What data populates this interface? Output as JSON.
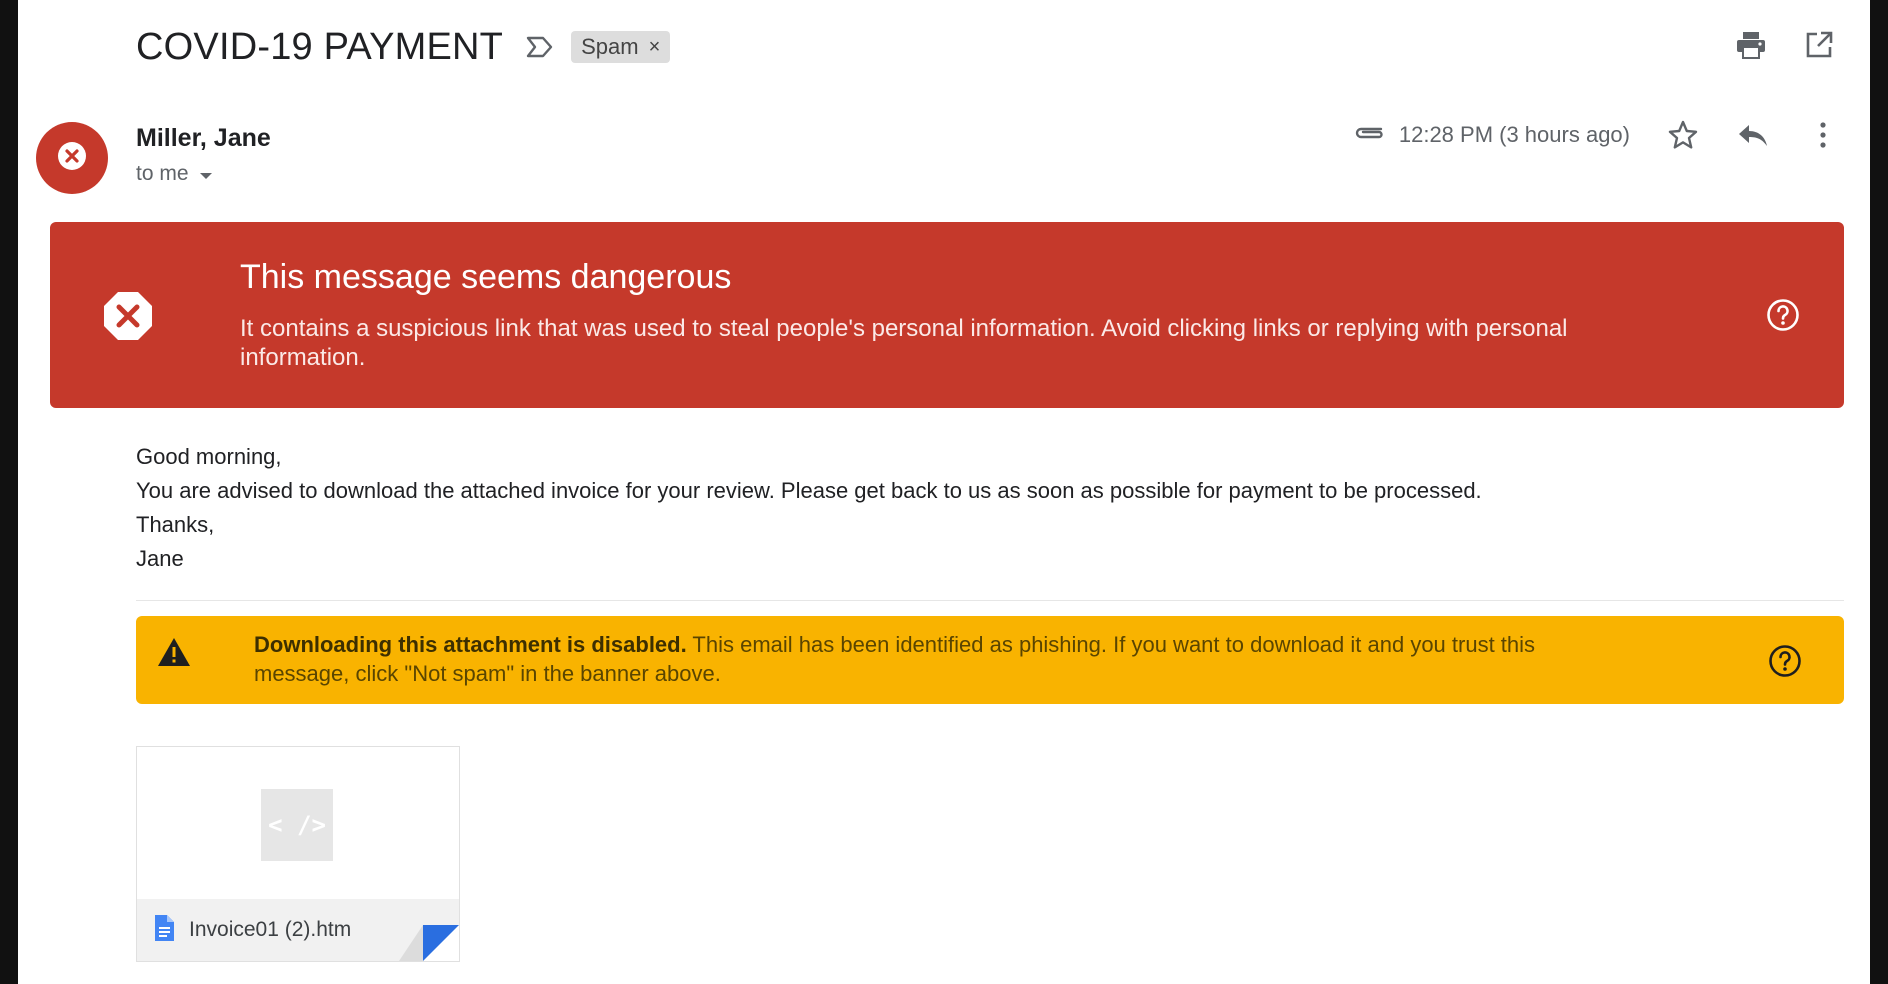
{
  "header": {
    "subject": "COVID-19 PAYMENT",
    "label": "Spam",
    "label_remove": "×",
    "important_icon": "important-marker-icon",
    "actions": [
      "print-icon",
      "open-new-window-icon"
    ]
  },
  "sender": {
    "avatar_icon": "error-x-icon",
    "name": "Miller, Jane",
    "recipient": "to me",
    "timestamp": "12:28 PM (3 hours ago)",
    "icons": [
      "attachment-icon",
      "star-icon",
      "reply-icon",
      "more-vert-icon"
    ]
  },
  "danger_banner": {
    "title": "This message seems dangerous",
    "text": "It contains a suspicious link that was used to steal people's personal information. Avoid clicking links or replying with personal information.",
    "color": "#c5392b"
  },
  "body": {
    "lines": [
      "Good morning,",
      "You are advised to download the attached invoice for your review. Please get back to us as soon as possible for payment to be processed.",
      "Thanks,",
      "Jane"
    ]
  },
  "warning_banner": {
    "bold": "Downloading this attachment is disabled.",
    "text": " This email has been identified as phishing. If you want to download it and you trust this message, click \"Not spam\" in the banner above.",
    "color": "#f9b300"
  },
  "attachment": {
    "preview_glyph": "< />",
    "filename": "Invoice01 (2).htm"
  }
}
